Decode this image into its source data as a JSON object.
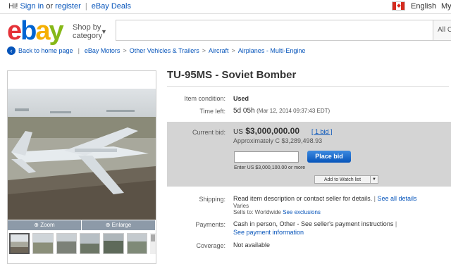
{
  "topbar": {
    "greeting": "Hi!",
    "sign_in": "Sign in",
    "or": "or",
    "register": "register",
    "ebay_deals": "eBay Deals",
    "language": "English",
    "my": "My"
  },
  "header": {
    "logo": {
      "e": "e",
      "b": "b",
      "a": "a",
      "y": "y"
    },
    "shop_by_1": "Shop by",
    "shop_by_2": "category",
    "search_placeholder": "",
    "category_select": "All C"
  },
  "breadcrumb": {
    "back": "Back to home page",
    "items": [
      "eBay Motors",
      "Other Vehicles & Trailers",
      "Aircraft",
      "Airplanes - Multi-Engine"
    ]
  },
  "image_panel": {
    "zoom": "Zoom",
    "enlarge": "Enlarge"
  },
  "item": {
    "title": "TU-95MS - Soviet Bomber",
    "condition_label": "Item condition:",
    "condition_value": "Used",
    "time_left_label": "Time left:",
    "time_left_value": "5d 05h",
    "time_left_date": "(Mar 12, 2014 09:37:43 EDT)",
    "current_bid_label": "Current bid:",
    "currency": "US",
    "price": "$3,000,000.00",
    "bids": "[ 1 bid ]",
    "approx": "Approximately C $3,289,498.93",
    "bid_input_value": "",
    "place_bid": "Place bid",
    "enter_note": "Enter US $3,000,100.00 or more",
    "watch_list": "Add to Watch list",
    "shipping_label": "Shipping:",
    "shipping_value": "Read item description or contact seller for details.",
    "see_all_details": "See all details",
    "varies": "Varies",
    "sells_to": "Sells to: Worldwide",
    "see_exclusions": "See exclusions",
    "payments_label": "Payments:",
    "payments_value": "Cash in person, Other - See seller's payment instructions",
    "payment_info": "See payment information",
    "coverage_label": "Coverage:",
    "coverage_value": "Not available"
  },
  "colors": {
    "link": "#0654ba",
    "bid_box": "#d4d4d4",
    "place_bid": "#0654ba"
  }
}
